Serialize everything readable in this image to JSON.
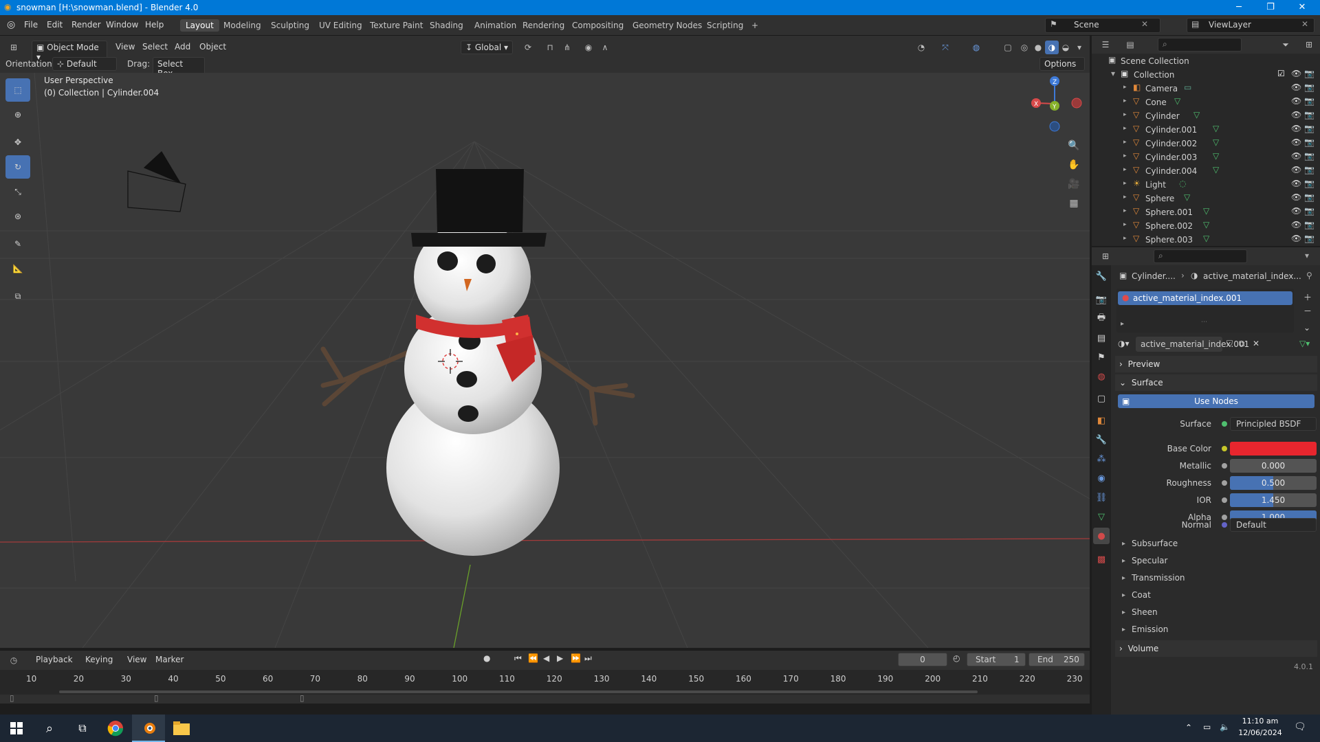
{
  "window": {
    "title": "snowman [H:\\snowman.blend] - Blender 4.0",
    "min": "─",
    "max": "❐",
    "close": "✕"
  },
  "menus": [
    "File",
    "Edit",
    "Render",
    "Window",
    "Help"
  ],
  "workspaces": [
    "Layout",
    "Modeling",
    "Sculpting",
    "UV Editing",
    "Texture Paint",
    "Shading",
    "Animation",
    "Rendering",
    "Compositing",
    "Geometry Nodes",
    "Scripting",
    "+"
  ],
  "scene": {
    "label": "Scene",
    "viewlayer": "ViewLayer"
  },
  "viewport_header": {
    "mode": "Object Mode",
    "menus": [
      "View",
      "Select",
      "Add",
      "Object"
    ],
    "transform": "Global",
    "orientation_label": "Orientation:",
    "orientation": "Default",
    "drag_label": "Drag:",
    "drag": "Select Box",
    "options": "Options"
  },
  "viewport": {
    "perspective": "User Perspective",
    "collection_info": "(0) Collection | Cylinder.004",
    "axes": {
      "x": "X",
      "y": "Y",
      "z": "Z"
    }
  },
  "outliner": {
    "root": "Scene Collection",
    "collection": "Collection",
    "items": [
      "Camera",
      "Cone",
      "Cylinder",
      "Cylinder.001",
      "Cylinder.002",
      "Cylinder.003",
      "Cylinder.004",
      "Light",
      "Sphere",
      "Sphere.001",
      "Sphere.002",
      "Sphere.003"
    ]
  },
  "properties": {
    "breadcrumb_object": "Cylinder....",
    "breadcrumb_material": "active_material_index...",
    "slot": "active_material_index.001",
    "material_name": "active_material_index.001",
    "preview": "Preview",
    "surface_panel": "Surface",
    "use_nodes": "Use Nodes",
    "surface_label": "Surface",
    "surface_value": "Principled BSDF",
    "fields": [
      {
        "label": "Base Color",
        "value": "",
        "fill": 0,
        "color": "#e8262e"
      },
      {
        "label": "Metallic",
        "value": "0.000",
        "fill": 0
      },
      {
        "label": "Roughness",
        "value": "0.500",
        "fill": 0.5
      },
      {
        "label": "IOR",
        "value": "1.450",
        "fill": 0.5
      },
      {
        "label": "Alpha",
        "value": "1.000",
        "fill": 1
      }
    ],
    "normal_label": "Normal",
    "normal_value": "Default",
    "subpanels": [
      "Subsurface",
      "Specular",
      "Transmission",
      "Coat",
      "Sheen",
      "Emission"
    ],
    "volume": "Volume",
    "version": "4.0.1"
  },
  "timeline": {
    "menus": [
      "Playback",
      "Keying",
      "View",
      "Marker"
    ],
    "current_frame": "0",
    "start_label": "Start",
    "start": "1",
    "end_label": "End",
    "end": "250",
    "ticks": [
      "10",
      "20",
      "30",
      "40",
      "50",
      "60",
      "70",
      "80",
      "90",
      "100",
      "110",
      "120",
      "130",
      "140",
      "150",
      "160",
      "170",
      "180",
      "190",
      "200",
      "210",
      "220",
      "230"
    ]
  },
  "taskbar": {
    "time": "11:10 am",
    "date": "12/06/2024"
  }
}
